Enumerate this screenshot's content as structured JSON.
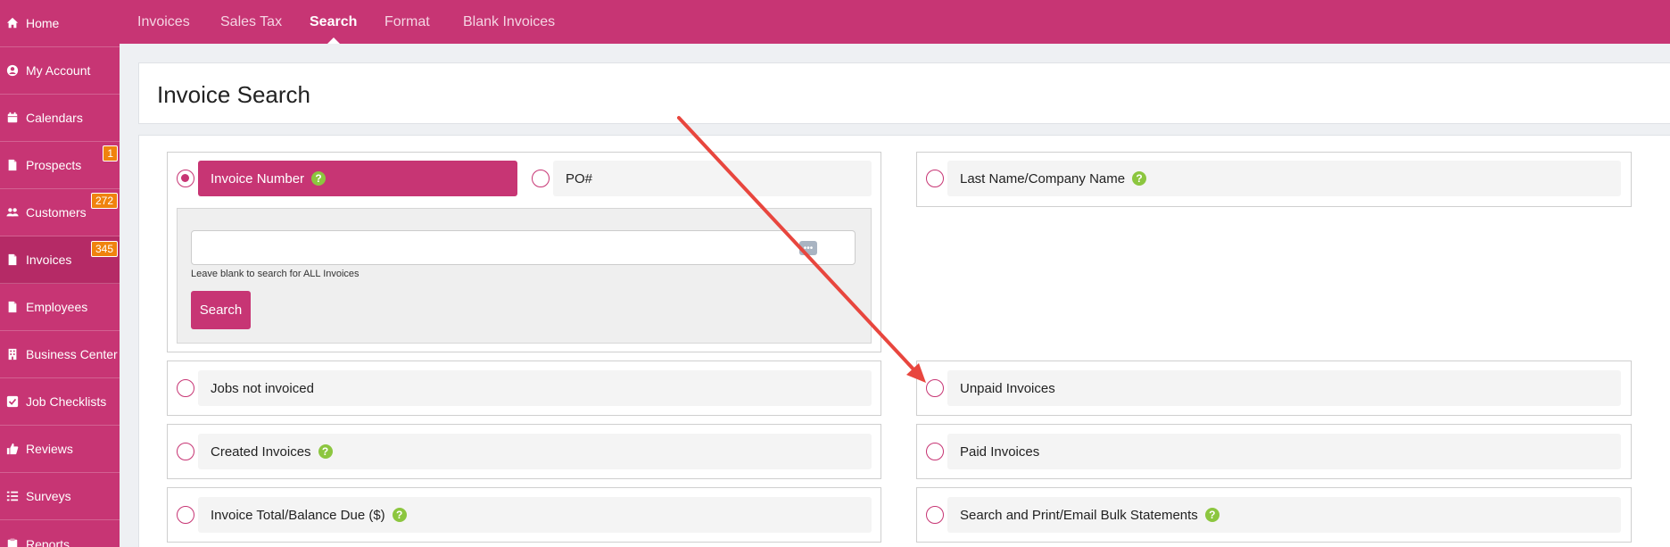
{
  "sidebar": {
    "items": [
      {
        "label": "Home",
        "icon": "home-icon"
      },
      {
        "label": "My Account",
        "icon": "user-circle-icon"
      },
      {
        "label": "Calendars",
        "icon": "calendar-icon"
      },
      {
        "label": "Prospects",
        "icon": "file-icon",
        "badge": "1"
      },
      {
        "label": "Customers",
        "icon": "users-icon",
        "badge": "272"
      },
      {
        "label": "Invoices",
        "icon": "file-icon",
        "badge": "345",
        "active": true
      },
      {
        "label": "Employees",
        "icon": "file-icon"
      },
      {
        "label": "Business Center",
        "icon": "building-icon"
      },
      {
        "label": "Job Checklists",
        "icon": "checkbox-icon"
      },
      {
        "label": "Reviews",
        "icon": "thumbs-up-icon"
      },
      {
        "label": "Surveys",
        "icon": "list-icon"
      },
      {
        "label": "Reports",
        "icon": "clipboard-icon"
      }
    ]
  },
  "topnav": {
    "tabs": [
      {
        "label": "Invoices"
      },
      {
        "label": "Sales Tax"
      },
      {
        "label": "Search",
        "active": true
      },
      {
        "label": "Format"
      },
      {
        "label": "Blank Invoices"
      }
    ]
  },
  "page": {
    "title": "Invoice Search"
  },
  "search": {
    "options": {
      "invoice_number": "Invoice Number",
      "po": "PO#",
      "last_name_company": "Last Name/Company Name",
      "jobs_not_invoiced": "Jobs not invoiced",
      "unpaid_invoices": "Unpaid Invoices",
      "created_invoices": "Created Invoices",
      "paid_invoices": "Paid Invoices",
      "invoice_total_balance": "Invoice Total/Balance Due ($)",
      "bulk_statements": "Search and Print/Email Bulk Statements"
    },
    "selected": "invoice_number",
    "input_value": "",
    "input_placeholder": "",
    "hint": "Leave blank to search for ALL Invoices",
    "button_label": "Search",
    "help_glyph": "?",
    "input_icon_glyph": "•••"
  },
  "colors": {
    "brand": "#c73574",
    "badge": "#f0830e",
    "help": "#8cc63f",
    "annotation_arrow": "#e8463e"
  }
}
